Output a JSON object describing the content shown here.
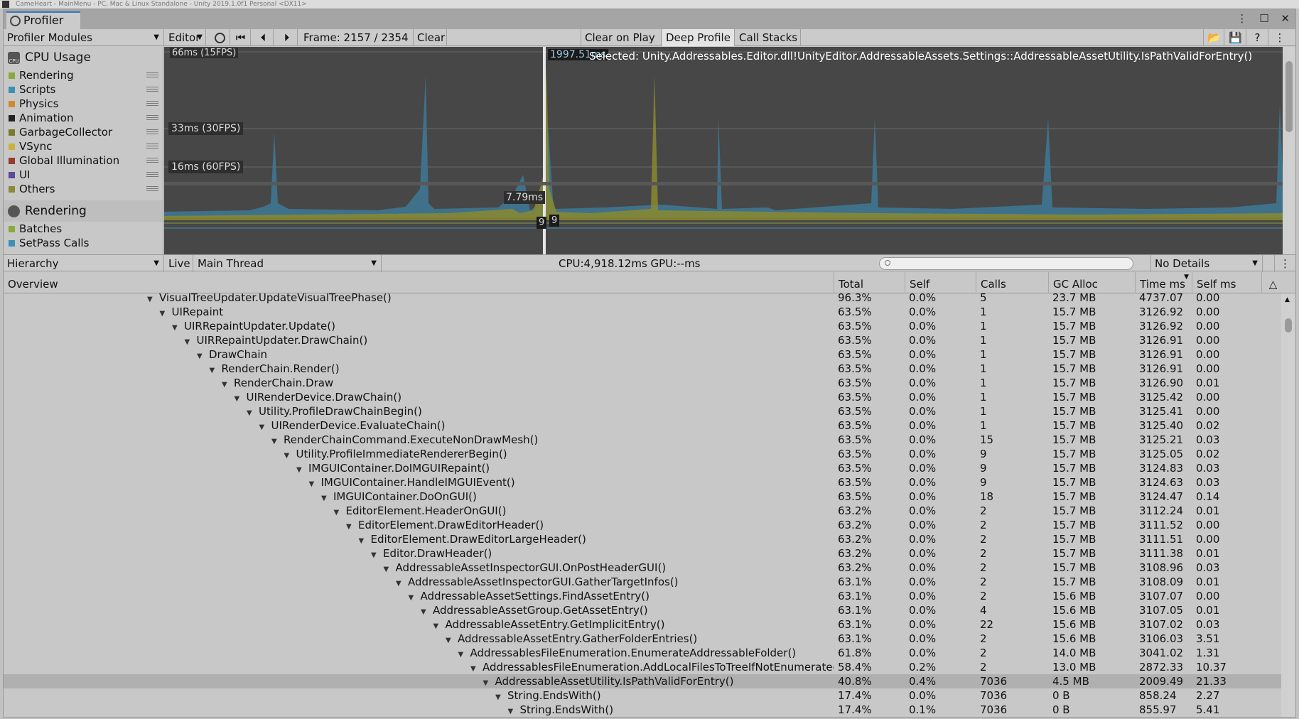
{
  "window": {
    "os_title": "CameHeart - MainMenu - PC, Mac & Linux Standalone - Unity 2019.1.0f1 Personal <DX11>",
    "tab_title": "Profiler"
  },
  "toolbar": {
    "modules_dropdown": "Profiler Modules",
    "target_dropdown": "Editor",
    "frame_label": "Frame: 2157 / 2354",
    "clear": "Clear",
    "clear_on_play": "Clear on Play",
    "deep_profile": "Deep Profile",
    "call_stacks": "Call Stacks"
  },
  "modules": {
    "cpu": {
      "title": "CPU Usage",
      "items": [
        {
          "label": "Rendering",
          "color": "#8ca83a"
        },
        {
          "label": "Scripts",
          "color": "#3e8fb8"
        },
        {
          "label": "Physics",
          "color": "#d08a2e"
        },
        {
          "label": "Animation",
          "color": "#222222"
        },
        {
          "label": "GarbageCollector",
          "color": "#7a7a2a"
        },
        {
          "label": "VSync",
          "color": "#c8b43a"
        },
        {
          "label": "Global Illumination",
          "color": "#9a3a2a"
        },
        {
          "label": "UI",
          "color": "#5a4a9a"
        },
        {
          "label": "Others",
          "color": "#8a8a3a"
        }
      ]
    },
    "rendering": {
      "title": "Rendering",
      "items": [
        {
          "label": "Batches",
          "color": "#8ca83a"
        },
        {
          "label": "SetPass Calls",
          "color": "#3e8fb8"
        }
      ]
    }
  },
  "graph": {
    "line_66": "66ms (15FPS)",
    "line_33": "33ms (30FPS)",
    "line_16": "16ms (60FPS)",
    "cursor_value": "1997.51ms",
    "cursor_value_2": "7.79ms",
    "cursor_count_a": "9",
    "cursor_count_b": "9",
    "selected_text": "Selected: Unity.Addressables.Editor.dll!UnityEditor.AddressableAssets.Settings::AddressableAssetUtility.IsPathValidForEntry()"
  },
  "details_bar": {
    "view_dropdown": "Hierarchy",
    "live": "Live",
    "thread_dropdown": "Main Thread",
    "cpu_gpu": "CPU:4,918.12ms   GPU:--ms",
    "search_placeholder": "",
    "details_dropdown": "No Details"
  },
  "columns": {
    "overview": "Overview",
    "total": "Total",
    "self": "Self",
    "calls": "Calls",
    "gc_alloc": "GC Alloc",
    "time_ms": "Time ms",
    "self_ms": "Self ms"
  },
  "rows": [
    {
      "depth": 0,
      "name": "VisualTreeUpdater.UpdateVisualTreePhase()",
      "total": "96.3%",
      "self": "0.0%",
      "calls": "5",
      "gc": "23.7 MB",
      "time": "4737.07",
      "selfms": "0.00"
    },
    {
      "depth": 1,
      "name": "UIRepaint",
      "total": "63.5%",
      "self": "0.0%",
      "calls": "1",
      "gc": "15.7 MB",
      "time": "3126.92",
      "selfms": "0.00"
    },
    {
      "depth": 2,
      "name": "UIRRepaintUpdater.Update()",
      "total": "63.5%",
      "self": "0.0%",
      "calls": "1",
      "gc": "15.7 MB",
      "time": "3126.92",
      "selfms": "0.00"
    },
    {
      "depth": 3,
      "name": "UIRRepaintUpdater.DrawChain()",
      "total": "63.5%",
      "self": "0.0%",
      "calls": "1",
      "gc": "15.7 MB",
      "time": "3126.91",
      "selfms": "0.00"
    },
    {
      "depth": 4,
      "name": "DrawChain",
      "total": "63.5%",
      "self": "0.0%",
      "calls": "1",
      "gc": "15.7 MB",
      "time": "3126.91",
      "selfms": "0.00"
    },
    {
      "depth": 5,
      "name": "RenderChain.Render()",
      "total": "63.5%",
      "self": "0.0%",
      "calls": "1",
      "gc": "15.7 MB",
      "time": "3126.91",
      "selfms": "0.00"
    },
    {
      "depth": 6,
      "name": "RenderChain.Draw",
      "total": "63.5%",
      "self": "0.0%",
      "calls": "1",
      "gc": "15.7 MB",
      "time": "3126.90",
      "selfms": "0.01"
    },
    {
      "depth": 7,
      "name": "UIRenderDevice.DrawChain()",
      "total": "63.5%",
      "self": "0.0%",
      "calls": "1",
      "gc": "15.7 MB",
      "time": "3125.42",
      "selfms": "0.00"
    },
    {
      "depth": 8,
      "name": "Utility.ProfileDrawChainBegin()",
      "total": "63.5%",
      "self": "0.0%",
      "calls": "1",
      "gc": "15.7 MB",
      "time": "3125.41",
      "selfms": "0.00"
    },
    {
      "depth": 9,
      "name": "UIRenderDevice.EvaluateChain()",
      "total": "63.5%",
      "self": "0.0%",
      "calls": "1",
      "gc": "15.7 MB",
      "time": "3125.40",
      "selfms": "0.02"
    },
    {
      "depth": 10,
      "name": "RenderChainCommand.ExecuteNonDrawMesh()",
      "total": "63.5%",
      "self": "0.0%",
      "calls": "15",
      "gc": "15.7 MB",
      "time": "3125.21",
      "selfms": "0.03"
    },
    {
      "depth": 11,
      "name": "Utility.ProfileImmediateRendererBegin()",
      "total": "63.5%",
      "self": "0.0%",
      "calls": "9",
      "gc": "15.7 MB",
      "time": "3125.05",
      "selfms": "0.02"
    },
    {
      "depth": 12,
      "name": "IMGUIContainer.DoIMGUIRepaint()",
      "total": "63.5%",
      "self": "0.0%",
      "calls": "9",
      "gc": "15.7 MB",
      "time": "3124.83",
      "selfms": "0.03"
    },
    {
      "depth": 13,
      "name": "IMGUIContainer.HandleIMGUIEvent()",
      "total": "63.5%",
      "self": "0.0%",
      "calls": "9",
      "gc": "15.7 MB",
      "time": "3124.63",
      "selfms": "0.03"
    },
    {
      "depth": 14,
      "name": "IMGUIContainer.DoOnGUI()",
      "total": "63.5%",
      "self": "0.0%",
      "calls": "18",
      "gc": "15.7 MB",
      "time": "3124.47",
      "selfms": "0.14"
    },
    {
      "depth": 15,
      "name": "EditorElement.HeaderOnGUI()",
      "total": "63.2%",
      "self": "0.0%",
      "calls": "2",
      "gc": "15.7 MB",
      "time": "3112.24",
      "selfms": "0.01"
    },
    {
      "depth": 16,
      "name": "EditorElement.DrawEditorHeader()",
      "total": "63.2%",
      "self": "0.0%",
      "calls": "2",
      "gc": "15.7 MB",
      "time": "3111.52",
      "selfms": "0.00"
    },
    {
      "depth": 17,
      "name": "EditorElement.DrawEditorLargeHeader()",
      "total": "63.2%",
      "self": "0.0%",
      "calls": "2",
      "gc": "15.7 MB",
      "time": "3111.51",
      "selfms": "0.00"
    },
    {
      "depth": 18,
      "name": "Editor.DrawHeader()",
      "total": "63.2%",
      "self": "0.0%",
      "calls": "2",
      "gc": "15.7 MB",
      "time": "3111.38",
      "selfms": "0.01"
    },
    {
      "depth": 19,
      "name": "AddressableAssetInspectorGUI.OnPostHeaderGUI()",
      "total": "63.2%",
      "self": "0.0%",
      "calls": "2",
      "gc": "15.7 MB",
      "time": "3108.96",
      "selfms": "0.03"
    },
    {
      "depth": 20,
      "name": "AddressableAssetInspectorGUI.GatherTargetInfos()",
      "total": "63.1%",
      "self": "0.0%",
      "calls": "2",
      "gc": "15.7 MB",
      "time": "3108.09",
      "selfms": "0.01"
    },
    {
      "depth": 21,
      "name": "AddressableAssetSettings.FindAssetEntry()",
      "total": "63.1%",
      "self": "0.0%",
      "calls": "2",
      "gc": "15.6 MB",
      "time": "3107.07",
      "selfms": "0.00"
    },
    {
      "depth": 22,
      "name": "AddressableAssetGroup.GetAssetEntry()",
      "total": "63.1%",
      "self": "0.0%",
      "calls": "4",
      "gc": "15.6 MB",
      "time": "3107.05",
      "selfms": "0.01"
    },
    {
      "depth": 23,
      "name": "AddressableAssetEntry.GetImplicitEntry()",
      "total": "63.1%",
      "self": "0.0%",
      "calls": "22",
      "gc": "15.6 MB",
      "time": "3107.02",
      "selfms": "0.03"
    },
    {
      "depth": 24,
      "name": "AddressableAssetEntry.GatherFolderEntries()",
      "total": "63.1%",
      "self": "0.0%",
      "calls": "2",
      "gc": "15.6 MB",
      "time": "3106.03",
      "selfms": "3.51"
    },
    {
      "depth": 25,
      "name": "AddressablesFileEnumeration.EnumerateAddressableFolder()",
      "total": "61.8%",
      "self": "0.0%",
      "calls": "2",
      "gc": "14.0 MB",
      "time": "3041.02",
      "selfms": "1.31"
    },
    {
      "depth": 26,
      "name": "AddressablesFileEnumeration.AddLocalFilesToTreeIfNotEnumerated",
      "total": "58.4%",
      "self": "0.2%",
      "calls": "2",
      "gc": "13.0 MB",
      "time": "2872.33",
      "selfms": "10.37"
    },
    {
      "depth": 27,
      "name": "AddressableAssetUtility.IsPathValidForEntry()",
      "total": "40.8%",
      "self": "0.4%",
      "calls": "7036",
      "gc": "4.5 MB",
      "time": "2009.49",
      "selfms": "21.33",
      "selected": true
    },
    {
      "depth": 28,
      "name": "String.EndsWith()",
      "total": "17.4%",
      "self": "0.0%",
      "calls": "7036",
      "gc": "0 B",
      "time": "858.24",
      "selfms": "2.27"
    },
    {
      "depth": 29,
      "name": "String.EndsWith()",
      "total": "17.4%",
      "self": "0.1%",
      "calls": "7036",
      "gc": "0 B",
      "time": "855.97",
      "selfms": "5.41"
    }
  ]
}
